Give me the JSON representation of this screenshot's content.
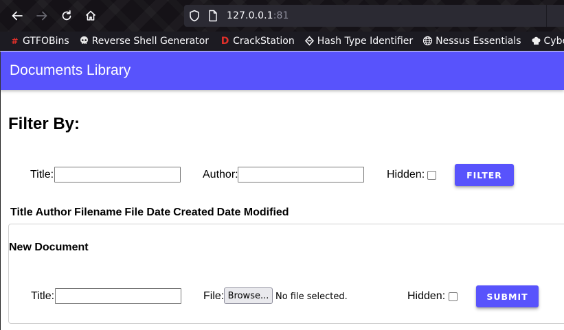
{
  "browser": {
    "url_host": "127.0.0.1",
    "url_port": ":81",
    "bookmarks": [
      {
        "label": "GTFOBins",
        "icon": "gtfobins-icon",
        "glyph": "#",
        "color": "#e0302a"
      },
      {
        "label": "Reverse Shell Generator",
        "icon": "skull-icon",
        "glyph": "💀",
        "color": "#dddddd"
      },
      {
        "label": "CrackStation",
        "icon": "crackstation-icon",
        "glyph": "D",
        "color": "#e0302a"
      },
      {
        "label": "Hash Type Identifier",
        "icon": "hash-identifier-icon",
        "glyph": "⊖",
        "color": "#ffffff"
      },
      {
        "label": "Nessus Essentials",
        "icon": "globe-icon",
        "glyph": "🌐",
        "color": "#ffffff"
      },
      {
        "label": "CyberChef",
        "icon": "chef-hat-icon",
        "glyph": "♛",
        "color": "#ffffff"
      }
    ]
  },
  "app": {
    "title": "Documents Library",
    "accent": "#5853fc"
  },
  "filter": {
    "heading": "Filter By:",
    "title_label": "Title:",
    "author_label": "Author:",
    "hidden_label": "Hidden:",
    "title_value": "",
    "author_value": "",
    "hidden_checked": false,
    "button_label": "FILTER"
  },
  "table": {
    "columns": [
      "Title",
      "Author",
      "Filename",
      "File Date",
      "Created",
      "Date Modified"
    ]
  },
  "new_document": {
    "heading": "New Document",
    "title_label": "Title:",
    "title_value": "",
    "file_label": "File:",
    "browse_label": "Browse...",
    "file_status": "No file selected.",
    "hidden_label": "Hidden:",
    "hidden_checked": false,
    "button_label": "SUBMIT"
  }
}
